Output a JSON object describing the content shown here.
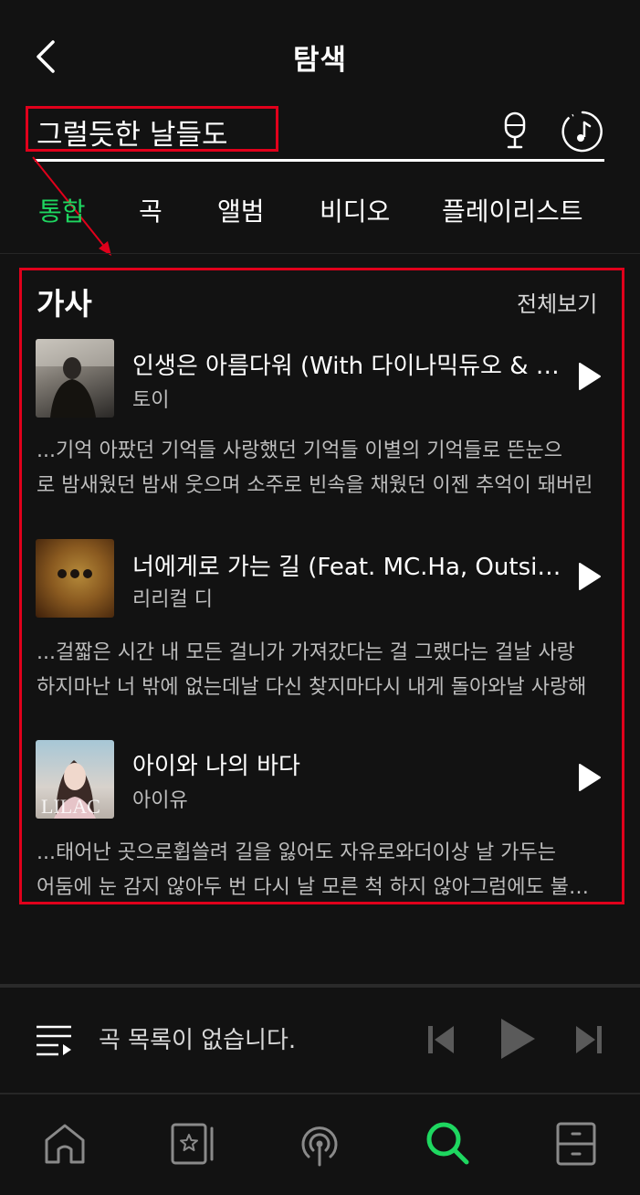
{
  "header": {
    "title": "탐색"
  },
  "search": {
    "query": "그럴듯한 날들도"
  },
  "tabs": [
    {
      "label": "통합",
      "active": true
    },
    {
      "label": "곡"
    },
    {
      "label": "앨범"
    },
    {
      "label": "비디오"
    },
    {
      "label": "플레이리스트"
    }
  ],
  "lyrics_section": {
    "title": "가사",
    "see_all": "전체보기",
    "items": [
      {
        "title": "인생은 아름다워 (With 다이나믹듀오 & 나윤권)",
        "artist": "토이",
        "lyric_line1": "...기억 아팠던 기억들 사랑했던 기억들 이별의 기억들로 뜬눈으",
        "lyric_line2": "로 밤새웠던 밤새 웃으며 소주로 빈속을 채웠던 이젠 추억이 돼버린"
      },
      {
        "title": "너에게로 가는 길 (Feat. MC.Ha, Outsider)",
        "artist": "리리컬 디",
        "lyric_line1": "...걸짧은 시간 내 모든 걸니가 가져갔다는 걸 그랬다는 걸날 사랑",
        "lyric_line2": "하지마난 너 밖에 없는데날 다신 찾지마다시 내게 돌아와날 사랑해"
      },
      {
        "title": "아이와 나의 바다",
        "artist": "아이유",
        "lyric_line1": "...태어난 곳으로휩쓸려 길을 잃어도 자유로와더이상 날 가두는",
        "lyric_line2": "어둠에 눈 감지 않아두 번 다시 날 모른 척 하지 않아그럼에도 불구하고"
      }
    ]
  },
  "player": {
    "status": "곡 목록이 없습니다."
  },
  "nav": [
    {
      "icon": "home-icon"
    },
    {
      "icon": "library-icon"
    },
    {
      "icon": "podcast-icon"
    },
    {
      "icon": "search-icon",
      "active": true
    },
    {
      "icon": "drawer-icon"
    }
  ],
  "colors": {
    "accent": "#1ed760",
    "highlight": "#e0001b",
    "background": "#121212"
  }
}
